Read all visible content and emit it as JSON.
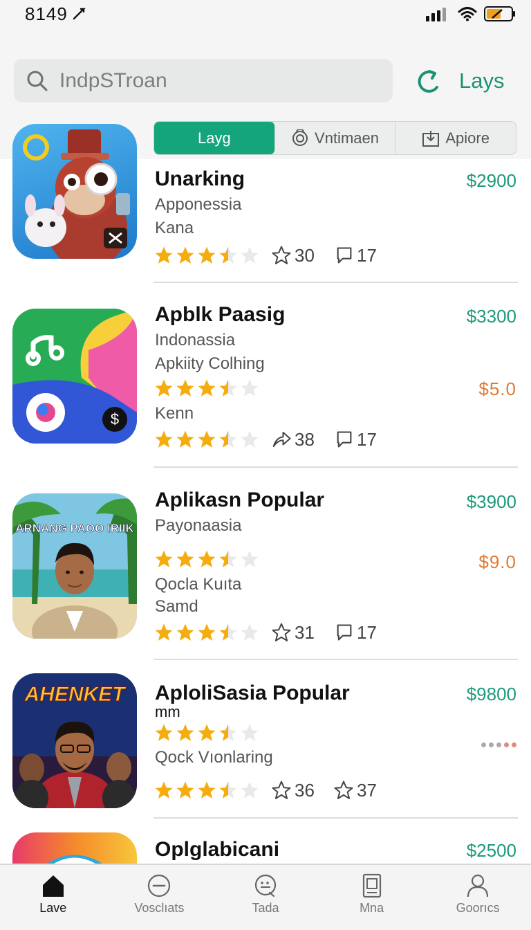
{
  "status": {
    "time": "8149"
  },
  "search": {
    "placeholder": "IndpSTroan"
  },
  "header": {
    "action_label": "Lays"
  },
  "segments": [
    {
      "label": "Layg",
      "icon": "none",
      "active": true
    },
    {
      "label": "Vntimaen",
      "icon": "camera-icon",
      "active": false
    },
    {
      "label": "Apiore",
      "icon": "download-box-icon",
      "active": false
    }
  ],
  "apps": [
    {
      "title": "Unarking",
      "lines": [
        "Apponessia",
        "Kana"
      ],
      "price": "$2900",
      "secondary_price": "",
      "rating": 3.5,
      "star_count": "30",
      "comment_count": "17"
    },
    {
      "title": "Apblk Paasig",
      "lines": [
        "Indonassia",
        "Apkiity Colhing",
        "Kenn"
      ],
      "price": "$3300",
      "secondary_price": "$5.0",
      "rating": 3.5,
      "star_count": "38",
      "comment_count": "17"
    },
    {
      "title": "Aplikasn Popular",
      "lines": [
        "Payonaasia",
        "Qocla Kuıta",
        "Samd"
      ],
      "price": "$3900",
      "secondary_price": "$9.0",
      "rating": 3.5,
      "star_count": "31",
      "comment_count": "17"
    },
    {
      "title": "AploliSasia Popular",
      "lines": [
        "mm",
        "Qock Vıonlaring"
      ],
      "price": "$9800",
      "secondary_price": "",
      "rating": 3.5,
      "star_count": "36",
      "comment_count": "37"
    },
    {
      "title": "Oplglabicani",
      "lines": [],
      "price": "$2500"
    }
  ],
  "icon_text": {
    "app3_banner": "ARNANG PAOO IRIIK",
    "app4_banner": "AHENKET"
  },
  "tabs": [
    {
      "label": "Lave",
      "icon": "home-icon",
      "active": true
    },
    {
      "label": "Vosclıats",
      "icon": "minus-circle-icon",
      "active": false
    },
    {
      "label": "Tada",
      "icon": "chat-icon",
      "active": false
    },
    {
      "label": "Mna",
      "icon": "device-icon",
      "active": false
    },
    {
      "label": "Goorıcs",
      "icon": "profile-icon",
      "active": false
    }
  ],
  "colors": {
    "accent": "#15a57c",
    "price": "#1d9a7c",
    "secondary_price": "#e07a35",
    "star": "#f5ac0f"
  }
}
